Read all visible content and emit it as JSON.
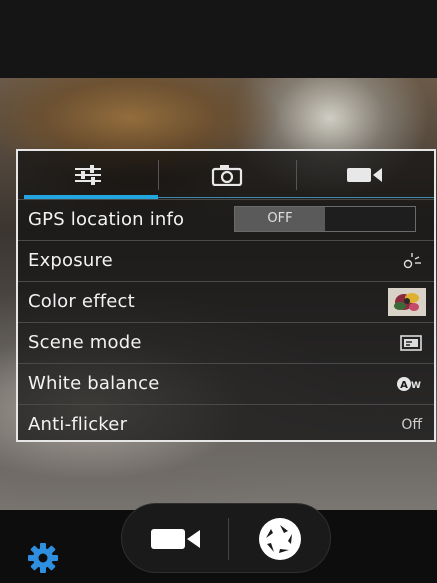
{
  "tabs": [
    {
      "icon": "sliders-icon",
      "selected": true
    },
    {
      "icon": "camera-icon",
      "selected": false
    },
    {
      "icon": "video-camera-icon",
      "selected": false
    }
  ],
  "settings": {
    "gps": {
      "label": "GPS location info",
      "value": "OFF"
    },
    "exposure": {
      "label": "Exposure",
      "icon": "exposure-icon"
    },
    "color_effect": {
      "label": "Color effect",
      "icon": "color-effect-thumbnail-icon"
    },
    "scene_mode": {
      "label": "Scene mode",
      "icon": "scene-mode-icon"
    },
    "white_balance": {
      "label": "White balance",
      "icon": "auto-white-balance-icon",
      "icon_text": "AW"
    },
    "anti_flicker": {
      "label": "Anti-flicker",
      "value": "Off"
    }
  },
  "controls": {
    "video_icon": "video-camera-icon",
    "shutter_icon": "aperture-shutter-icon",
    "settings_icon": "gear-icon"
  },
  "colors": {
    "accent": "#23a5e0",
    "settings_gear": "#2e8fe0"
  }
}
